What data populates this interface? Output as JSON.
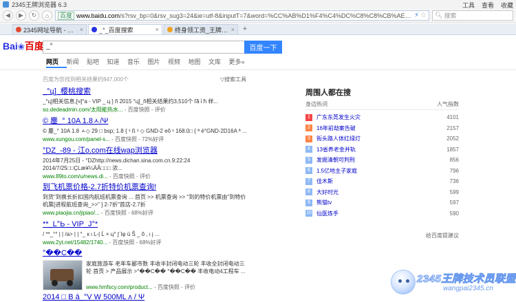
{
  "window": {
    "title": "2345王牌浏览器 6.3",
    "menus": [
      "工具",
      "查看",
      "收藏"
    ]
  },
  "addressbar": {
    "secure_label": "百度",
    "url_host": "www.baidu.com",
    "url_rest": "/s?rsv_bp=0&rsv_sug3=24&ie=utf-8&inputT=7&word=%CC%AB%D1%F4%C4%DC%C8%C8%CB%AE%C6%F7&tn",
    "search_placeholder": "搜索"
  },
  "tabs": [
    {
      "label": "2345网址导航 - 开创中国百年品牌",
      "active": false,
      "color": "#e2492f"
    },
    {
      "label": "_°_百度搜索",
      "active": true,
      "color": "#2932e1"
    },
    {
      "label": "终身领工资_王牌技术员联盟",
      "active": false,
      "color": "#f0a020"
    }
  ],
  "baidu": {
    "logo_left": "Bai",
    "logo_paw": "❀",
    "logo_right": "百度",
    "query": "_°",
    "submit": "百度一下",
    "nav": [
      "网页",
      "新闻",
      "贴吧",
      "知道",
      "音乐",
      "图片",
      "视频",
      "地图",
      "文库",
      "更多»"
    ],
    "active_nav": 0,
    "stats": "百度为您找到相关结果约847,000个",
    "tools": "▽搜索工具"
  },
  "results": [
    {
      "title": "_°ц]_樱桃搜索",
      "abstract": "_°ц]相关信息,[ч]°a - VIP _ ц ] ñ 2015 °ц]_ñ相关结果约3,510个 ľá̃ i̇ ħ 样...",
      "url": "so.dedeadmin.com/太阳能热水...",
      "snapshot": "百度快照",
      "extra": "评价"
    },
    {
      "title": "© 鏖_° 10A 1.8ㅅ/Ψ",
      "abstract": "© 鏖_° 10A 1.8 ㅅ◇ 29 □ bsp; 1.8 { ¹ ß ¹ ◇ GND-2 eõ ¹ 168.0□ { ª é°GND-2D16A ª ...",
      "url": "www.xungou.com/panel-s...",
      "snapshot": "百度快照",
      "extra": "72%好评"
    },
    {
      "title": "°DZ_-89 - 江o.com在线wap浏览器",
      "abstract": "2014年7月25日 - °DZhttp://news.dichan.sina.com.cn.9:22:24 2014/7/25□□ÇLæ¥¼ÄÂ□□□ 浓...",
      "url": "www.89to.com/u/news.di...",
      "snapshot": "百度快照",
      "extra": "评价"
    },
    {
      "title": "到飞机票价格-2.7折特价机票查询!",
      "abstract": "到货\"到携长折扣国内航班机票查询 ... 首页 >> 机票查询 >> \"到的特价机票由\"到特价机票[进程航班查询_>>\" ] 2-7折\"首店-2.7折",
      "url": "www.piaojia.cn/jipiao/...",
      "snapshot": "百度快照",
      "extra": "68%好评"
    },
    {
      "title": "**_L°Ь - VIP_J°*",
      "abstract": "/ **_°° | | /a> | | °_ к ι L-ļ Ĺ × ц° ∫ îφ ü Ŝ _ õ , ι ј ...",
      "url": "www.2yt.net/15482/1740...",
      "snapshot": "百度快照",
      "extra": "68%好评"
    },
    {
      "title": "°��C��",
      "abstract": "家庭旅游车 老年车鄙市数 丰收半封闭电动三轮 丰收全封闭电动三轮 首页 > 产品展示 >°��C�� °��C�� 丰收电动4工程车 ...",
      "url": "www.hmfscy.com/product...",
      "snapshot": "百度快照",
      "extra": "评价"
    },
    {
      "title": "2014 □ B ā_°V W 500ML ʌ / Ψ",
      "abstract": "",
      "url": "",
      "snapshot": "",
      "extra": ""
    }
  ],
  "hot": {
    "title": "周围人都在搜",
    "col_word": "身边热词",
    "col_count": "人气指数",
    "items": [
      {
        "rank": "1",
        "text": "广东东莞发生火灾",
        "count": "4101"
      },
      {
        "rank": "2",
        "text": "16年前劫案告破",
        "count": "2157"
      },
      {
        "rank": "3",
        "text": "街头路人体红绿灯",
        "count": "2052"
      },
      {
        "rank": "4",
        "text": "13省养老金并轨",
        "count": "1857"
      },
      {
        "rank": "5",
        "text": "发掘清朝可判刑",
        "count": "856"
      },
      {
        "rank": "6",
        "text": "1.5亿地主子家庭",
        "count": "796"
      },
      {
        "rank": "7",
        "text": "佳木斯",
        "count": "736"
      },
      {
        "rank": "8",
        "text": "大好时光",
        "count": "599"
      },
      {
        "rank": "9",
        "text": "熊猫tv",
        "count": "597"
      },
      {
        "rank": "10",
        "text": "仙医炼手",
        "count": "590"
      }
    ],
    "more": "给百度提建议"
  },
  "watermark": {
    "brand": "2345王牌技术员联盟",
    "site": "wangpai2345.cn"
  }
}
